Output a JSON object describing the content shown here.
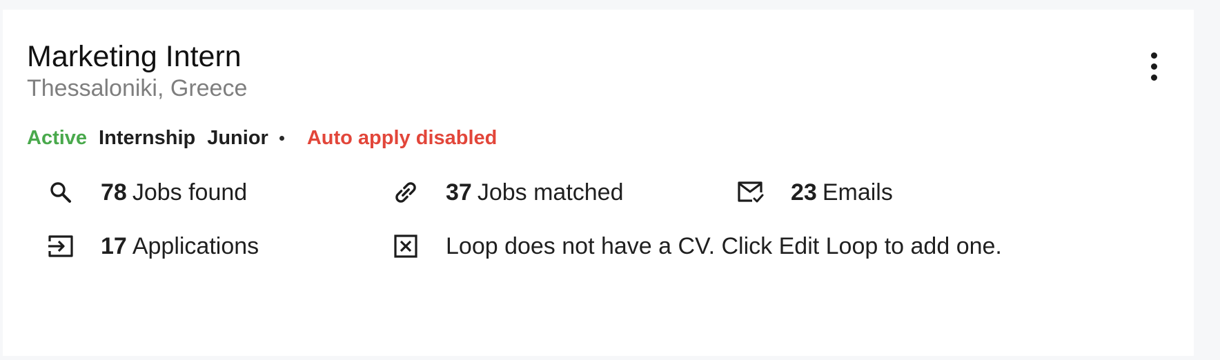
{
  "card": {
    "title": "Marketing Intern",
    "location": "Thessaloniki, Greece",
    "menu_icon": "more-vertical-icon"
  },
  "tags": {
    "status": "Active",
    "type": "Internship",
    "level": "Junior",
    "auto_apply": "Auto apply disabled",
    "colors": {
      "active": "#49a94c",
      "auto_apply": "#e2463a"
    }
  },
  "stats": {
    "jobs_found": {
      "icon": "search-icon",
      "count": "78",
      "label": "Jobs found"
    },
    "jobs_matched": {
      "icon": "link-icon",
      "count": "37",
      "label": "Jobs matched"
    },
    "emails": {
      "icon": "mail-check-icon",
      "count": "23",
      "label": "Emails"
    },
    "applications": {
      "icon": "input-arrow-icon",
      "count": "17",
      "label": "Applications"
    },
    "cv_notice": {
      "icon": "close-box-icon",
      "text": "Loop does not have a CV. Click Edit Loop to add one."
    }
  }
}
